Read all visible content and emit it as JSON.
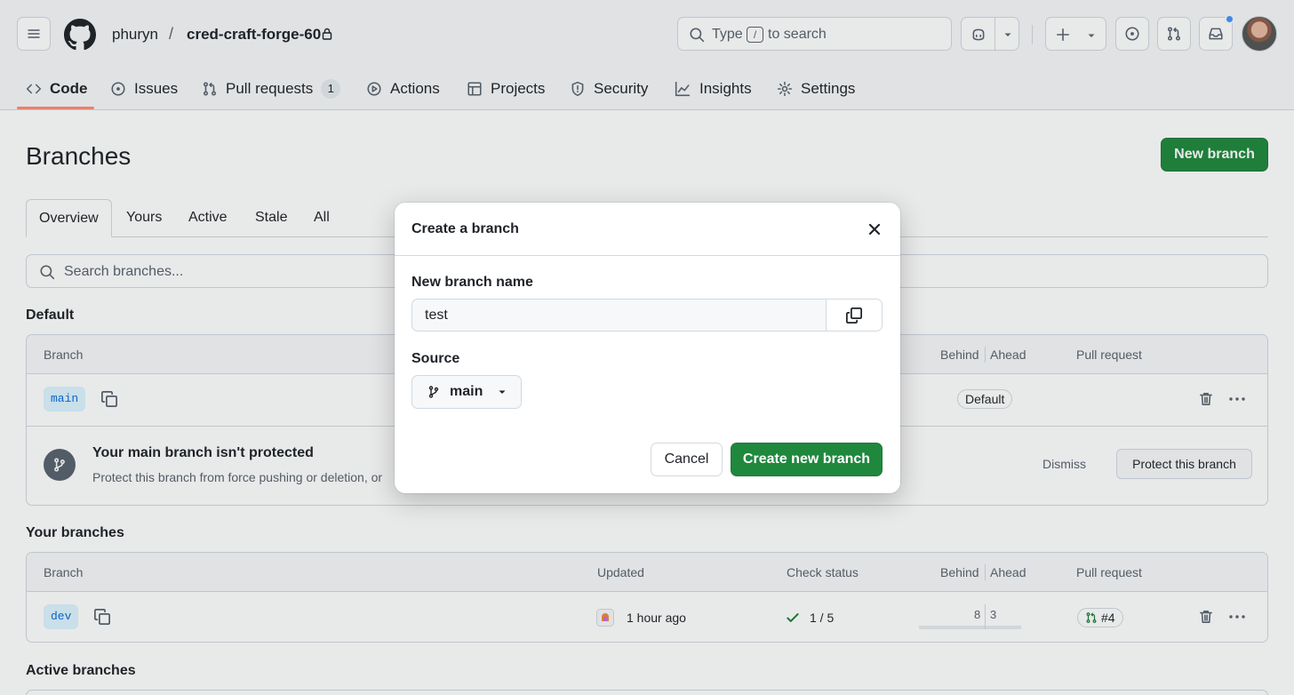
{
  "header": {
    "owner": "phuryn",
    "separator": "/",
    "repo": "cred-craft-forge-60",
    "search": {
      "prefix": "Type",
      "key": "/",
      "suffix": "to search"
    }
  },
  "nav": {
    "tabs": [
      {
        "label": "Code",
        "icon": "code-icon",
        "selected": true
      },
      {
        "label": "Issues",
        "icon": "issue-icon"
      },
      {
        "label": "Pull requests",
        "icon": "pull-request-icon",
        "count": "1"
      },
      {
        "label": "Actions",
        "icon": "play-icon"
      },
      {
        "label": "Projects",
        "icon": "table-icon"
      },
      {
        "label": "Security",
        "icon": "shield-icon"
      },
      {
        "label": "Insights",
        "icon": "graph-icon"
      },
      {
        "label": "Settings",
        "icon": "gear-icon"
      }
    ]
  },
  "page": {
    "title": "Branches",
    "new_branch_label": "New branch",
    "subtabs": [
      "Overview",
      "Yours",
      "Active",
      "Stale",
      "All"
    ],
    "search_placeholder": "Search branches..."
  },
  "default_section": {
    "title": "Default",
    "headers": {
      "branch": "Branch",
      "behind": "Behind",
      "ahead": "Ahead",
      "pull_request": "Pull request"
    },
    "branch": "main",
    "badge": "Default",
    "protection": {
      "title": "Your main branch isn't protected",
      "description": "Protect this branch from force pushing or deletion, or",
      "dismiss": "Dismiss",
      "protect_button": "Protect this branch"
    }
  },
  "your_section": {
    "title": "Your branches",
    "headers": {
      "branch": "Branch",
      "updated": "Updated",
      "check_status": "Check status",
      "behind": "Behind",
      "ahead": "Ahead",
      "pull_request": "Pull request"
    },
    "row": {
      "branch": "dev",
      "updated": "1 hour ago",
      "checks": "1 / 5",
      "behind": "8",
      "ahead": "3",
      "pr": "#4"
    }
  },
  "active_section": {
    "title": "Active branches"
  },
  "modal": {
    "title": "Create a branch",
    "name_label": "New branch name",
    "name_value": "test",
    "source_label": "Source",
    "source_value": "main",
    "cancel": "Cancel",
    "create": "Create new branch"
  },
  "colors": {
    "primary": "#1f883d",
    "accent_tab": "#fd8c73",
    "link": "#0969da",
    "notification": "#4493f8"
  }
}
